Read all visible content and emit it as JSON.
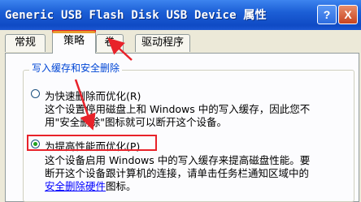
{
  "window": {
    "title": "Generic USB Flash Disk USB Device 属性",
    "help_label": "?",
    "close_label": "X"
  },
  "tabs": [
    {
      "label": "常规"
    },
    {
      "label": "策略"
    },
    {
      "label": "卷"
    },
    {
      "label": "驱动程序"
    }
  ],
  "group": {
    "label": "写入缓存和安全删除",
    "options": [
      {
        "label": "为快速删除而优化(R)",
        "desc": [
          "这个设置停用磁盘上和 Windows 中的写入缓存，因此您不",
          "用\"安全删除\"图标就可以断开这个设备。"
        ],
        "checked": false
      },
      {
        "label": "为提高性能而优化(P)",
        "desc": [
          "这个设备启用 Windows 中的写入缓存来提高磁盘性能。要",
          "断开这个设备跟计算机的连接，请单击任务栏通知区域中的"
        ],
        "link": "安全删除硬件",
        "link_suffix": "图标。",
        "checked": true
      }
    ]
  },
  "annotation_colors": {
    "red": "#e8222a"
  }
}
